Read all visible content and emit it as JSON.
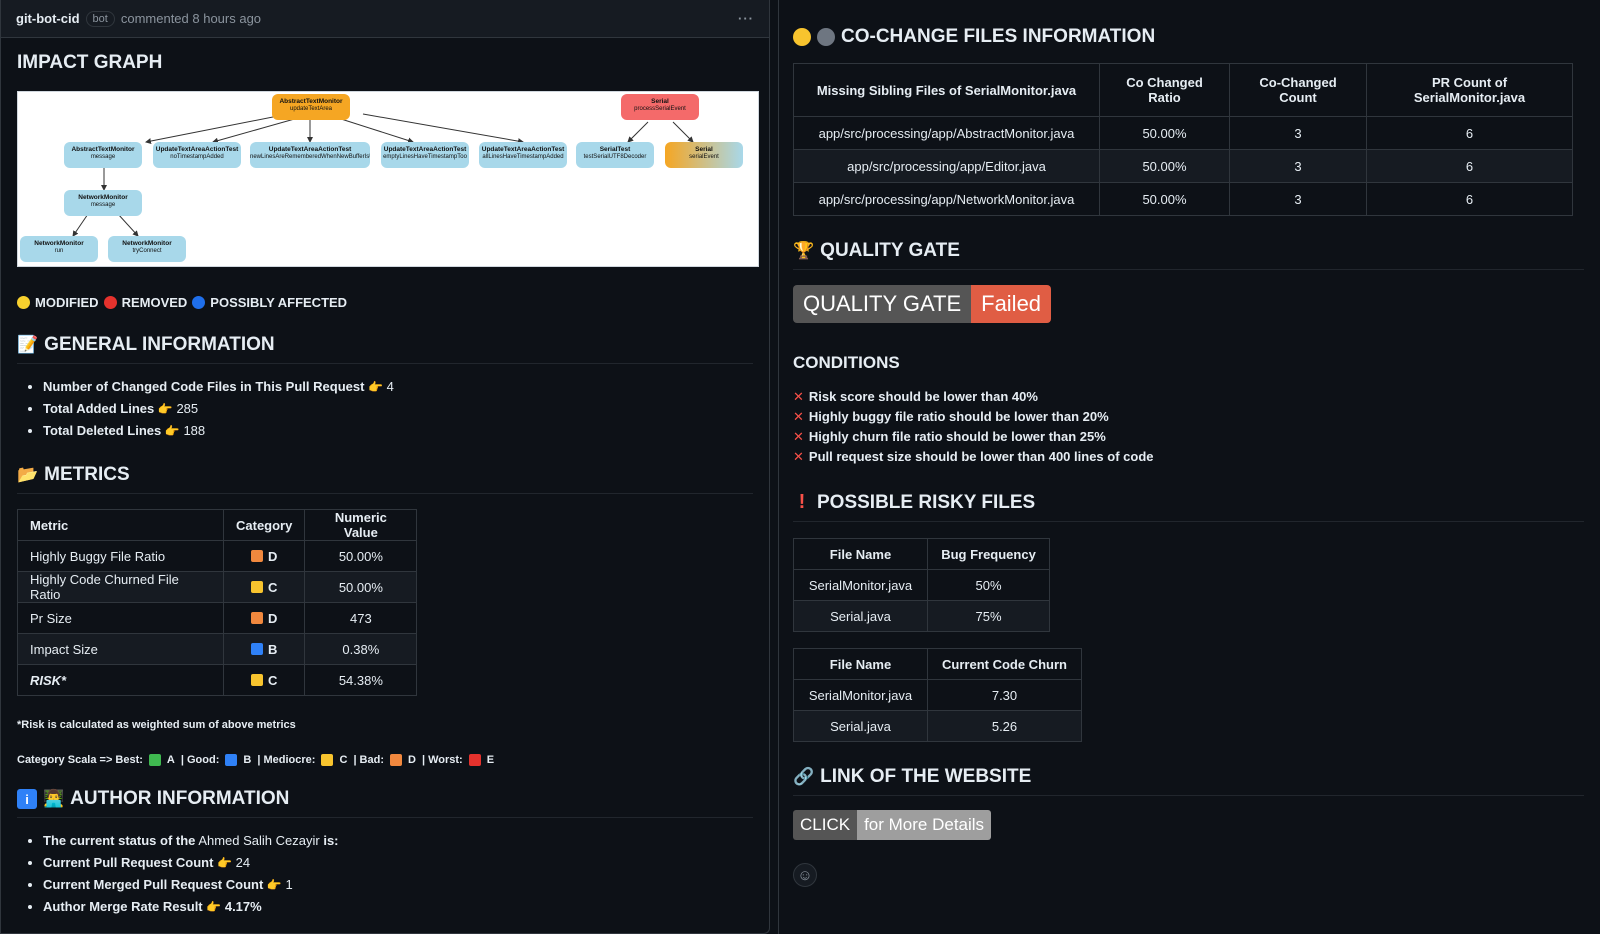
{
  "comment": {
    "author": "git-bot-cid",
    "bot_label": "bot",
    "meta": "commented 8 hours ago",
    "menu": "···"
  },
  "impact_graph": {
    "title": "IMPACT GRAPH",
    "nodes": [
      {
        "name": "AbstractTextMonitor",
        "sub": "updateTextArea",
        "status": "modified"
      },
      {
        "name": "Serial",
        "sub": "processSerialEvent",
        "status": "removed"
      },
      {
        "name": "AbstractTextMonitor",
        "sub": "message",
        "status": "affected"
      },
      {
        "name": "UpdateTextAreaActionTest",
        "sub": "noTimestampAdded",
        "status": "affected"
      },
      {
        "name": "UpdateTextAreaActionTest",
        "sub": "newLinesAreRememberedWhenNewBufferIsUsed",
        "status": "affected"
      },
      {
        "name": "UpdateTextAreaActionTest",
        "sub": "emptyLinesHaveTimestampToo",
        "status": "affected"
      },
      {
        "name": "UpdateTextAreaActionTest",
        "sub": "allLinesHaveTimestampAdded",
        "status": "affected"
      },
      {
        "name": "SerialTest",
        "sub": "testSerialUTF8Decoder",
        "status": "affected"
      },
      {
        "name": "Serial",
        "sub": "serialEvent",
        "status": "mixed"
      },
      {
        "name": "NetworkMonitor",
        "sub": "message",
        "status": "affected"
      },
      {
        "name": "NetworkMonitor",
        "sub": "run",
        "status": "affected"
      },
      {
        "name": "NetworkMonitor",
        "sub": "tryConnect",
        "status": "affected"
      }
    ],
    "legend": [
      {
        "label": "MODIFIED",
        "color": "#f8d12e"
      },
      {
        "label": "REMOVED",
        "color": "#e5322d"
      },
      {
        "label": "POSSIBLY AFFECTED",
        "color": "#1f6feb"
      }
    ]
  },
  "general": {
    "title": "GENERAL INFORMATION",
    "items": [
      {
        "label": "Number of Changed Code Files in This Pull Request",
        "value": "4"
      },
      {
        "label": "Total Added Lines",
        "value": "285"
      },
      {
        "label": "Total Deleted Lines",
        "value": "188"
      }
    ]
  },
  "metrics": {
    "title": "METRICS",
    "headers": [
      "Metric",
      "Category",
      "Numeric Value"
    ],
    "rows": [
      {
        "metric": "Highly Buggy File Ratio",
        "category": "D",
        "color": "#f0883e",
        "value": "50.00%"
      },
      {
        "metric": "Highly Code Churned File Ratio",
        "category": "C",
        "color": "#f8c42e",
        "value": "50.00%"
      },
      {
        "metric": "Pr Size",
        "category": "D",
        "color": "#f0883e",
        "value": "473"
      },
      {
        "metric": "Impact Size",
        "category": "B",
        "color": "#2f81f7",
        "value": "0.38%"
      },
      {
        "metric": "RISK*",
        "category": "C",
        "color": "#f8c42e",
        "value": "54.38%"
      }
    ],
    "note": "*Risk is calculated as weighted sum of above metrics",
    "scala_prefix": "Category Scala => ",
    "scala": [
      {
        "label": "Best:",
        "color": "#3fb950",
        "grade": "A"
      },
      {
        "label": "Good:",
        "color": "#2f81f7",
        "grade": "B"
      },
      {
        "label": "Mediocre:",
        "color": "#f8c42e",
        "grade": "C"
      },
      {
        "label": "Bad:",
        "color": "#f0883e",
        "grade": "D"
      },
      {
        "label": "Worst:",
        "color": "#e5322d",
        "grade": "E"
      }
    ]
  },
  "author": {
    "title": "AUTHOR INFORMATION",
    "status_prefix": "The current status of the",
    "name": "Ahmed Salih Cezayir",
    "status_suffix": "is:",
    "items": [
      {
        "label": "Current Pull Request Count",
        "value": "24"
      },
      {
        "label": "Current Merged Pull Request Count",
        "value": "1"
      },
      {
        "label": "Author Merge Rate Result",
        "value": "4.17%"
      }
    ]
  },
  "cochange": {
    "title": "CO-CHANGE FILES INFORMATION",
    "headers": [
      "Missing Sibling Files of SerialMonitor.java",
      "Co Changed Ratio",
      "Co-Changed Count",
      "PR Count of SerialMonitor.java"
    ],
    "rows": [
      [
        "app/src/processing/app/AbstractMonitor.java",
        "50.00%",
        "3",
        "6"
      ],
      [
        "app/src/processing/app/Editor.java",
        "50.00%",
        "3",
        "6"
      ],
      [
        "app/src/processing/app/NetworkMonitor.java",
        "50.00%",
        "3",
        "6"
      ]
    ]
  },
  "quality_gate": {
    "title": "QUALITY GATE",
    "badge_left": "QUALITY GATE",
    "badge_right": "Failed",
    "conditions_title": "CONDITIONS",
    "conditions": [
      "Risk score should be lower than 40%",
      "Highly buggy file ratio should be lower than 20%",
      "Highly churn file ratio should be lower than 25%",
      "Pull request size should be lower than 400 lines of code"
    ]
  },
  "risky": {
    "title": "POSSIBLE RISKY FILES",
    "bug_headers": [
      "File Name",
      "Bug Frequency"
    ],
    "bug_rows": [
      [
        "SerialMonitor.java",
        "50%"
      ],
      [
        "Serial.java",
        "75%"
      ]
    ],
    "churn_headers": [
      "File Name",
      "Current Code Churn"
    ],
    "churn_rows": [
      [
        "SerialMonitor.java",
        "7.30"
      ],
      [
        "Serial.java",
        "5.26"
      ]
    ]
  },
  "website": {
    "title": "LINK OF THE WEBSITE",
    "badge_left": "CLICK",
    "badge_right": "for More Details"
  }
}
